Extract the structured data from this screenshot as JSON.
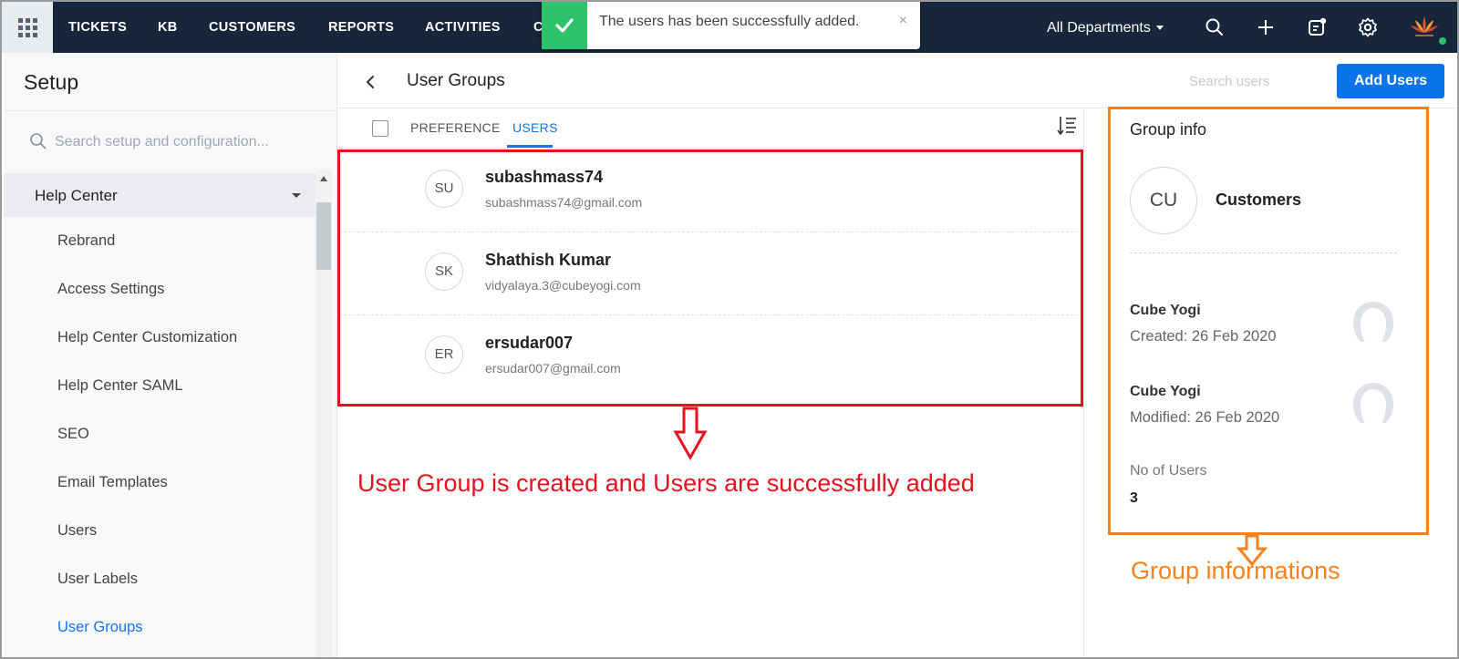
{
  "nav": {
    "items": [
      "TICKETS",
      "KB",
      "CUSTOMERS",
      "REPORTS",
      "ACTIVITIES",
      "C"
    ],
    "department": "All Departments"
  },
  "toast": {
    "message": "The users has been successfully added.",
    "close": "×"
  },
  "sidebar": {
    "title": "Setup",
    "search_placeholder": "Search setup and configuration...",
    "group_label": "Help Center",
    "items": [
      "Rebrand",
      "Access Settings",
      "Help Center Customization",
      "Help Center SAML",
      "SEO",
      "Email Templates",
      "Users",
      "User Labels",
      "User Groups"
    ],
    "active_item": "User Groups"
  },
  "header": {
    "title": "User Groups",
    "search_placeholder": "Search users",
    "add_button": "Add Users"
  },
  "tabs": {
    "preference": "PREFERENCE",
    "users": "USERS",
    "active": "USERS"
  },
  "users": [
    {
      "initials": "SU",
      "name": "subashmass74",
      "email": "subashmass74@gmail.com"
    },
    {
      "initials": "SK",
      "name": "Shathish Kumar",
      "email": "vidyalaya.3@cubeyogi.com"
    },
    {
      "initials": "ER",
      "name": "ersudar007",
      "email": "ersudar007@gmail.com"
    }
  ],
  "group_info": {
    "title": "Group info",
    "initials": "CU",
    "name": "Customers",
    "created_by": "Cube Yogi",
    "created": "Created: 26 Feb 2020",
    "modified_by": "Cube Yogi",
    "modified": "Modified: 26 Feb 2020",
    "count_label": "No of Users",
    "count": "3"
  },
  "annotations": {
    "users_note": "User Group is created and Users are successfully added",
    "group_note": "Group informations",
    "red": "#e8111f",
    "orange": "#f6821f"
  },
  "colors": {
    "nav_bg": "#17263a",
    "accent": "#1a73e8",
    "button": "#0a74e8",
    "success": "#2cc36b"
  }
}
